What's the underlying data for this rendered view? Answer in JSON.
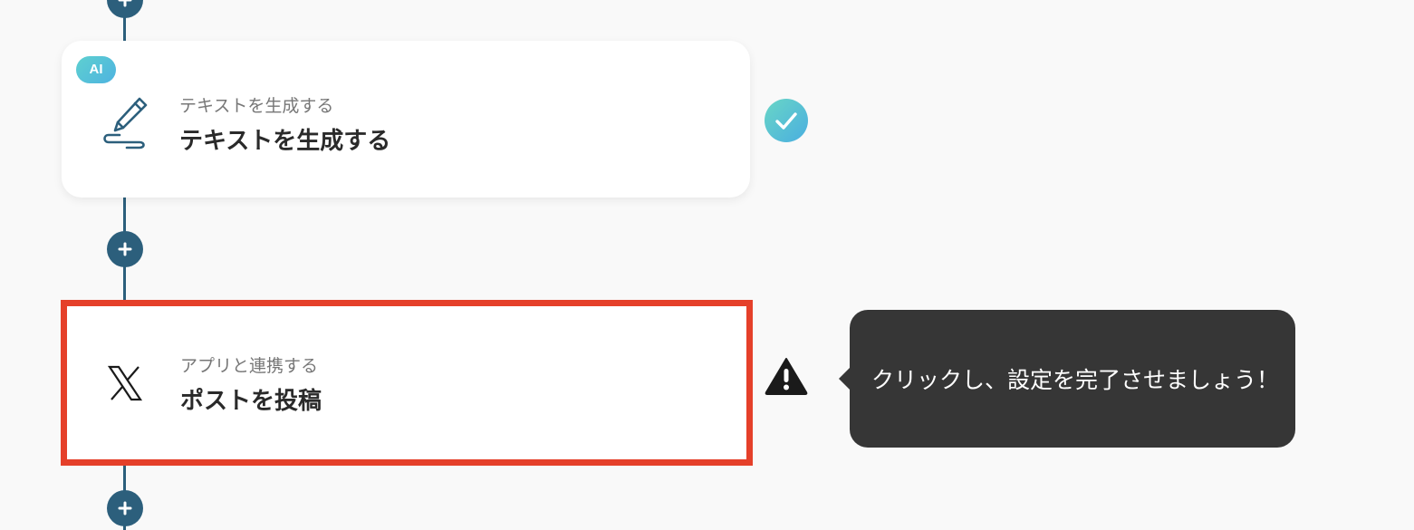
{
  "steps": [
    {
      "badge": "AI",
      "category": "テキストを生成する",
      "title": "テキストを生成する",
      "icon": "pen-scribble-icon",
      "status": "completed"
    },
    {
      "category": "アプリと連携する",
      "title": "ポストを投稿",
      "icon": "x-logo-icon",
      "status": "warning"
    }
  ],
  "tooltip": {
    "text": "クリックし、設定を完了させましょう！"
  },
  "colors": {
    "connector": "#2c5f7c",
    "highlight_border": "#e5402a",
    "tooltip_bg": "#363636",
    "check_gradient_start": "#69d6c6",
    "check_gradient_end": "#4aaee0",
    "background": "#f9f9f9"
  }
}
